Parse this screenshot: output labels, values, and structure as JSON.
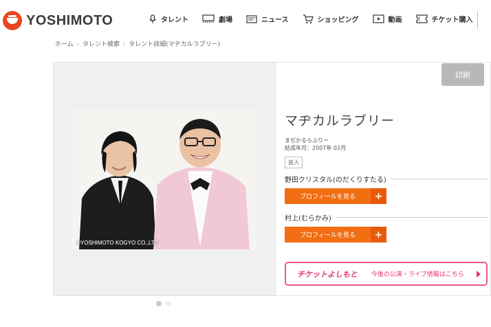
{
  "brand": {
    "name": "YOSHIMOTO",
    "accent": "#e8461e"
  },
  "nav": [
    {
      "label": "タレント",
      "icon": "microphone-icon"
    },
    {
      "label": "劇場",
      "icon": "theater-icon"
    },
    {
      "label": "ニュース",
      "icon": "news-icon"
    },
    {
      "label": "ショッピング",
      "icon": "cart-icon"
    },
    {
      "label": "動画",
      "icon": "video-icon"
    },
    {
      "label": "チケット購入",
      "icon": "ticket-icon"
    }
  ],
  "breadcrumb": [
    "ホーム",
    "タレント検索",
    "タレント詳細(マヂカルラブリー)"
  ],
  "print_label": "印刷",
  "photo": {
    "copyright": "©YOSHIMOTO KOGYO CO.,LTD"
  },
  "talent": {
    "name": "マヂカルラブリー",
    "reading": "まぢかるらぶりー",
    "formed": "結成年月：2007年 02月",
    "tag": "芸人"
  },
  "members": [
    {
      "name": "野田クリスタル(のだくりすたる)",
      "button": "プロフィールを見る",
      "plus": "+"
    },
    {
      "name": "村上(むらかみ)",
      "button": "プロフィールを見る",
      "plus": "+"
    }
  ],
  "ticket": {
    "logo": "チケットよしもと",
    "text": "今後の公演・ライブ情報はこちら"
  },
  "carousel": {
    "total": 2,
    "active": 1
  },
  "colors": {
    "orange": "#f26e12",
    "pink": "#e8347a",
    "print_bg": "#b8b8b8"
  }
}
